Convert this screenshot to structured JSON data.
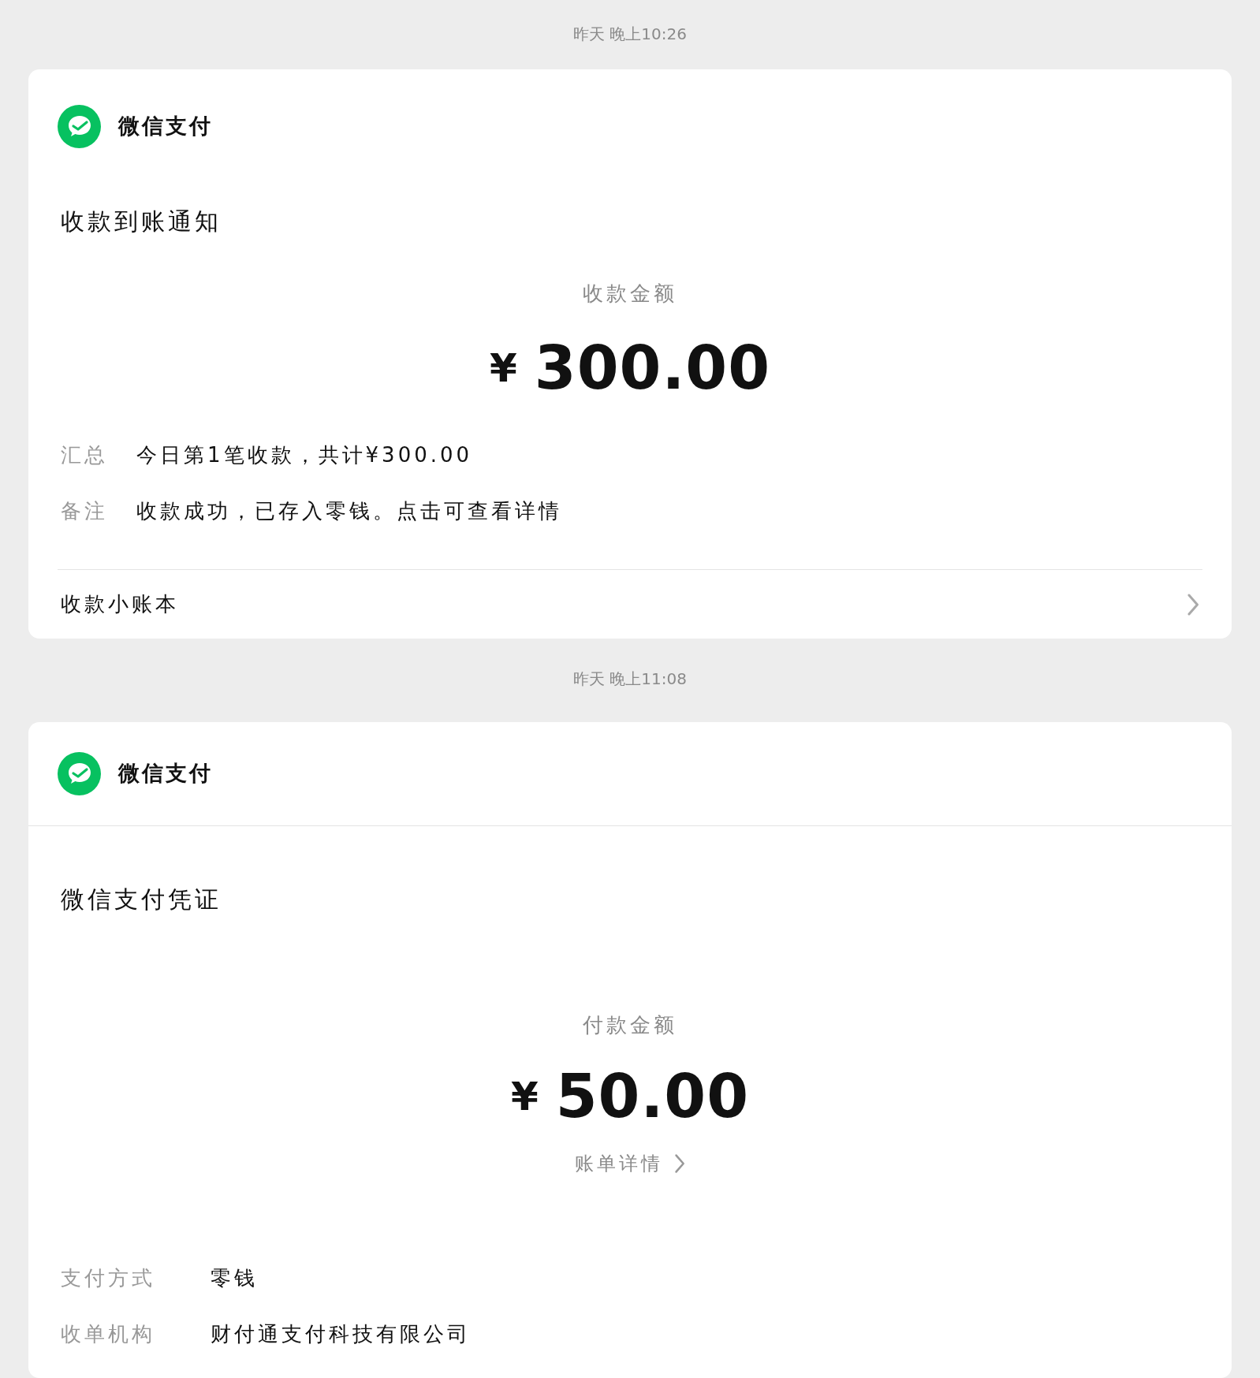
{
  "messages": [
    {
      "time": "昨天 晚上10:26",
      "card": {
        "kind": "notice",
        "brand": "微信支付",
        "header_divider": false,
        "title": "收款到账通知",
        "amount_label": "收款金额",
        "currency": "¥",
        "amount": "300.00",
        "fields": [
          {
            "label": "汇总",
            "value": "今日第1笔收款，共计¥300.00"
          },
          {
            "label": "备注",
            "value": "收款成功，已存入零钱。点击可查看详情"
          }
        ],
        "footer_link": "收款小账本"
      }
    },
    {
      "time": "昨天 晚上11:08",
      "card": {
        "kind": "voucher",
        "brand": "微信支付",
        "header_divider": true,
        "title": "微信支付凭证",
        "amount_label": "付款金额",
        "currency": "¥",
        "amount": "50.00",
        "detail_link": "账单详情",
        "fields": [
          {
            "label": "支付方式",
            "value": "零钱"
          },
          {
            "label": "收单机构",
            "value": "财付通支付科技有限公司"
          }
        ]
      }
    }
  ]
}
